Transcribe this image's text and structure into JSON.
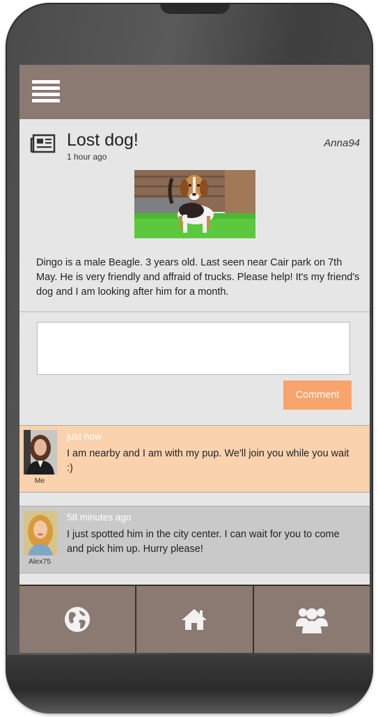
{
  "header": {
    "menu_icon": "hamburger-menu-icon"
  },
  "post": {
    "icon": "newspaper-icon",
    "title": "Lost dog!",
    "time": "1 hour ago",
    "author": "Anna94",
    "photo": "beagle-puppy-photo",
    "body": "Dingo is a male Beagle. 3 years old. Last seen near Cair park on 7th May. He is very friendly and affraid of trucks. Please help! It's my friend's dog and I am looking after him for a month."
  },
  "comment_form": {
    "value": "",
    "placeholder": "",
    "button_label": "Comment"
  },
  "comments": [
    {
      "user": "Me",
      "time": "just now",
      "text": "I am nearby and I am with my pup. We'll join you while you wait :)"
    },
    {
      "user": "Alex75",
      "time": "58 minutes ago",
      "text": "I just spotted him in the city center. I can wait for you to come and pick him up. Hurry please!"
    }
  ],
  "nav": [
    {
      "icon": "globe-icon"
    },
    {
      "icon": "home-icon"
    },
    {
      "icon": "users-icon"
    }
  ],
  "colors": {
    "header": "#8b7a72",
    "accent": "#f9a46c",
    "own_comment": "#fbd2ae",
    "other_comment": "#c9c9c9",
    "screen_bg": "#e6e6e6"
  }
}
